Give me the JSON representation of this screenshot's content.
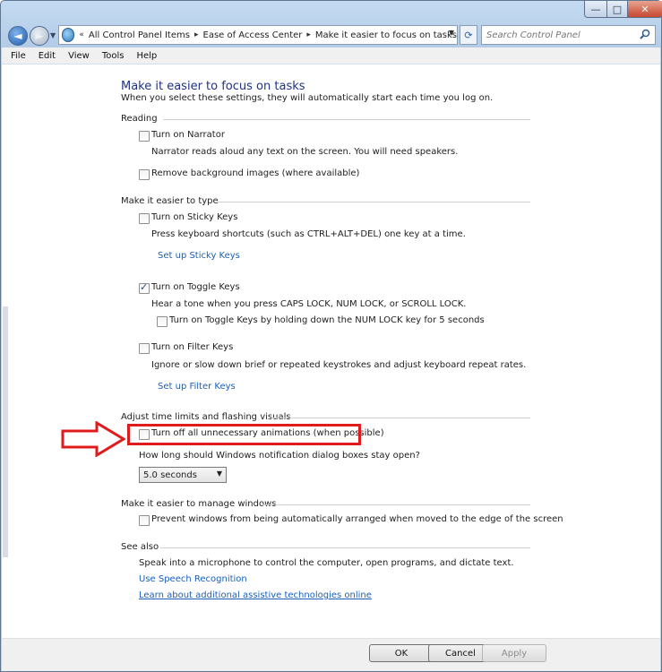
{
  "window": {
    "minimize_glyph": "—",
    "maximize_glyph": "□",
    "close_glyph": "✕"
  },
  "nav": {
    "back_glyph": "◄",
    "forward_glyph": "►",
    "breadcrumbs": [
      "All Control Panel Items",
      "Ease of Access Center",
      "Make it easier to focus on tasks"
    ],
    "breadcrumb_separator": "▸",
    "search_placeholder": "Search Control Panel"
  },
  "menu": [
    "File",
    "Edit",
    "View",
    "Tools",
    "Help"
  ],
  "page": {
    "title": "Make it easier to focus on tasks",
    "subtitle": "When you select these settings, they will automatically start each time you log on."
  },
  "sections": {
    "reading": {
      "heading": "Reading",
      "narrator_label": "Turn on Narrator",
      "narrator_checked": false,
      "narrator_desc": "Narrator reads aloud any text on the screen. You will need speakers.",
      "bg_images_label": "Remove background images (where available)",
      "bg_images_checked": false
    },
    "typing": {
      "heading": "Make it easier to type",
      "sticky_label": "Turn on Sticky Keys",
      "sticky_checked": false,
      "sticky_desc": "Press keyboard shortcuts (such as CTRL+ALT+DEL) one key at a time.",
      "sticky_link": "Set up Sticky Keys",
      "toggle_label": "Turn on Toggle Keys",
      "toggle_checked": true,
      "toggle_desc": "Hear a tone when you press CAPS LOCK, NUM LOCK, or SCROLL LOCK.",
      "toggle_hold_label": "Turn on Toggle Keys by holding down the NUM LOCK key for 5 seconds",
      "toggle_hold_checked": false,
      "filter_label": "Turn on Filter Keys",
      "filter_checked": false,
      "filter_desc": "Ignore or slow down brief or repeated keystrokes and adjust keyboard repeat rates.",
      "filter_link": "Set up Filter Keys"
    },
    "time": {
      "heading": "Adjust time limits and flashing visuals",
      "animations_label": "Turn off all unnecessary animations (when possible)",
      "animations_checked": false,
      "notif_question": "How long should Windows notification dialog boxes stay open?",
      "notif_value": "5.0 seconds"
    },
    "windows": {
      "heading": "Make it easier to manage windows",
      "arrange_label": "Prevent windows from being automatically arranged when moved to the edge of the screen",
      "arrange_checked": false
    },
    "see_also": {
      "heading": "See also",
      "speech_text": "Speak into a microphone to control the computer, open programs, and dictate text.",
      "speech_link": "Use Speech Recognition",
      "assistive_link": "Learn about additional assistive technologies online"
    }
  },
  "buttons": {
    "ok": "OK",
    "cancel": "Cancel",
    "apply": "Apply"
  },
  "colors": {
    "title_blue": "#1e3287",
    "link_blue": "#1b5fb8",
    "annotation_red": "#e01b1b"
  }
}
